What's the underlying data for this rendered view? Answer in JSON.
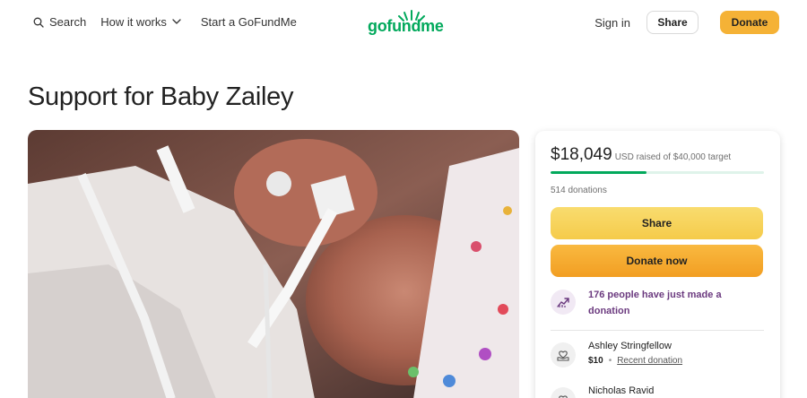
{
  "header": {
    "search_label": "Search",
    "how_it_works_label": "How it works",
    "start_label": "Start a GoFundMe",
    "logo_text": "gofundme",
    "sign_in_label": "Sign in",
    "share_label": "Share",
    "donate_label": "Donate"
  },
  "campaign": {
    "title": "Support for Baby Zailey"
  },
  "donation_card": {
    "raised_amount": "$18,049",
    "raised_text": "USD raised of $40,000 target",
    "progress_fraction": 0.45,
    "donation_count": "514 donations",
    "share_button": "Share",
    "donate_button": "Donate now",
    "recent_activity": "176 people have just made a donation",
    "donors": [
      {
        "name": "Ashley Stringfellow",
        "amount": "$10",
        "tag": "Recent donation"
      },
      {
        "name": "Nicholas Ravid"
      }
    ]
  },
  "colors": {
    "brand_green": "#02a95c",
    "donate_orange": "#f29e22",
    "share_yellow": "#f5cb4a",
    "activity_purple": "#6b3a7f"
  }
}
